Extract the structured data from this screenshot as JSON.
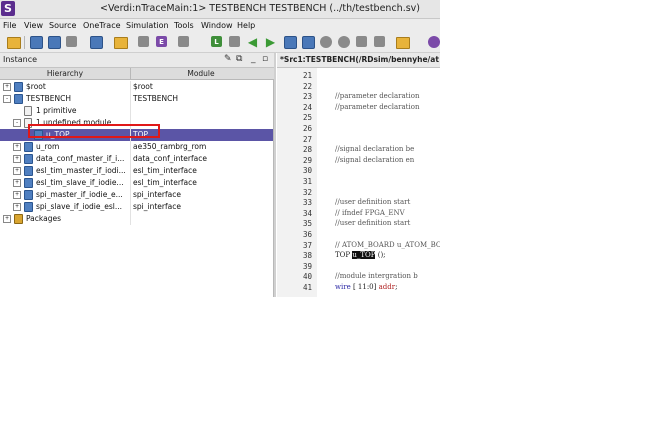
{
  "window": {
    "title": "<Verdi:nTraceMain:1> TESTBENCH TESTBENCH (../th/testbench.sv)",
    "app_icon_letter": "S"
  },
  "menu": [
    "File",
    "View",
    "Source",
    "OneTrace",
    "Simulation",
    "Tools",
    "Window",
    "Help"
  ],
  "toolbar": {
    "letter_buttons": [
      "L",
      "E"
    ]
  },
  "instance_panel": {
    "title": "Instance",
    "columns": {
      "hierarchy": "Hierarchy",
      "module": "Module"
    },
    "rows": [
      {
        "name": "$root",
        "module": "$root",
        "icon": "module-icon",
        "expander": "+"
      },
      {
        "name": "TESTBENCH",
        "module": "TESTBENCH",
        "icon": "module-icon",
        "expander": "-"
      },
      {
        "name": "1 primitive",
        "module": "",
        "icon": "document-icon",
        "expander": ""
      },
      {
        "name": "1 undefined module",
        "module": "",
        "icon": "document-icon",
        "expander": "-"
      },
      {
        "name": "u_TOP",
        "module": "TOP",
        "icon": "module-icon",
        "expander": "",
        "selected": true
      },
      {
        "name": "u_rom",
        "module": "ae350_rambrg_rom",
        "icon": "module-icon",
        "expander": "+"
      },
      {
        "name": "data_conf_master_if_i...",
        "module": "data_conf_interface",
        "icon": "module-icon",
        "expander": "+"
      },
      {
        "name": "esl_tim_master_if_iodi...",
        "module": "esl_tim_interface",
        "icon": "module-icon",
        "expander": "+"
      },
      {
        "name": "esl_tim_slave_if_iodie...",
        "module": "esl_tim_interface",
        "icon": "module-icon",
        "expander": "+"
      },
      {
        "name": "spi_master_if_iodie_e...",
        "module": "spi_interface",
        "icon": "module-icon",
        "expander": "+"
      },
      {
        "name": "spi_slave_if_iodie_esl...",
        "module": "spi_interface",
        "icon": "module-icon",
        "expander": "+"
      },
      {
        "name": "Packages",
        "module": "",
        "icon": "package-icon",
        "expander": "+"
      }
    ]
  },
  "source_panel": {
    "title": "*Src1:TESTBENCH(/RDsim/bennyhe/at",
    "lines": [
      {
        "num": "21",
        "text": ""
      },
      {
        "num": "22",
        "text": ""
      },
      {
        "num": "23",
        "text": "//parameter declaration"
      },
      {
        "num": "24",
        "text": "//parameter declaration"
      },
      {
        "num": "25",
        "text": ""
      },
      {
        "num": "26",
        "text": ""
      },
      {
        "num": "27",
        "text": ""
      },
      {
        "num": "28",
        "text": "//signal declaration be"
      },
      {
        "num": "29",
        "text": "//signal declaration en"
      },
      {
        "num": "30",
        "text": ""
      },
      {
        "num": "31",
        "text": ""
      },
      {
        "num": "32",
        "text": ""
      },
      {
        "num": "33",
        "text": "//user definition start"
      },
      {
        "num": "34",
        "text": "// ifndef FPGA_ENV"
      },
      {
        "num": "35",
        "text": "//user definition start"
      },
      {
        "num": "36",
        "text": ""
      },
      {
        "num": "37",
        "text": "// ATOM_BOARD u_ATOM_BO"
      },
      {
        "num": "38",
        "text_pre": "TOP ",
        "text_hl": "u_TOP",
        "text_post": " ();"
      },
      {
        "num": "39",
        "text": ""
      },
      {
        "num": "40",
        "text": "//module intergration b"
      },
      {
        "num": "41",
        "text_kw": "wire",
        "text_post": " [ 11:0] ",
        "text_sig": "addr",
        "text_end": ";"
      }
    ]
  }
}
